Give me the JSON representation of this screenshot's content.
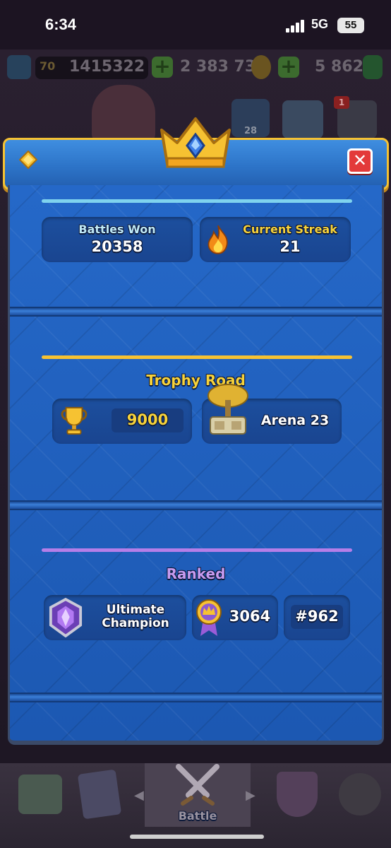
{
  "status_bar": {
    "time": "6:34",
    "network": "5G",
    "battery": "55"
  },
  "hud": {
    "level": "70",
    "trophies": "1415322",
    "gold": "2 383 737",
    "gems": "5 862",
    "friends_count": "28",
    "notification_badge": "1"
  },
  "stats": {
    "battles_won": {
      "label": "Battles Won",
      "value": "20358"
    },
    "current_streak": {
      "label": "Current Streak",
      "value": "21"
    }
  },
  "trophy_road": {
    "title": "Trophy Road",
    "trophies": "9000",
    "arena": "Arena 23"
  },
  "ranked": {
    "title": "Ranked",
    "league": "Ultimate Champion",
    "rating": "3064",
    "rank": "#962"
  },
  "bottom_nav": {
    "battle_label": "Battle"
  },
  "colors": {
    "accent_gold": "#f6c232",
    "streak_gold": "#f7d23a",
    "label_cyan": "#bfe9f7",
    "ranked_purple": "#c79bf0",
    "close_red": "#e33a3a",
    "panel_blue": "#1f5fbb"
  },
  "icons": [
    "gem-icon",
    "crown-icon",
    "close-icon",
    "flame-icon",
    "trophy-icon",
    "arena-icon",
    "league-badge-icon",
    "rating-medal-icon"
  ]
}
